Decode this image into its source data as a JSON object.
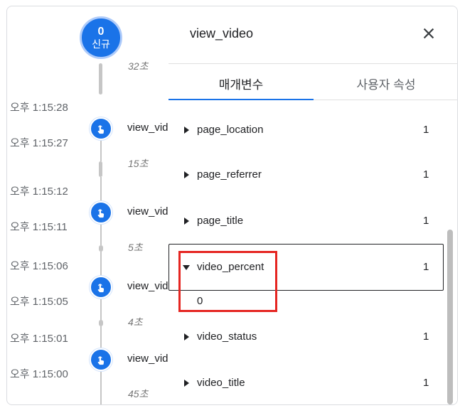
{
  "timeline": {
    "new_badge": {
      "count": "0",
      "label": "신규"
    },
    "gaps": [
      "32초",
      "15초",
      "5초",
      "4초",
      "45초"
    ],
    "events": [
      {
        "name": "view_video",
        "time_start": "오후 1:15:28",
        "time_end": "오후 1:15:27"
      },
      {
        "name": "view_video",
        "time_start": "오후 1:15:12",
        "time_end": "오후 1:15:11"
      },
      {
        "name": "view_video",
        "time_start": "오후 1:15:06",
        "time_end": "오후 1:15:05"
      },
      {
        "name": "view_video",
        "time_start": "오후 1:15:01",
        "time_end": "오후 1:15:00"
      }
    ],
    "icon": "touch-icon",
    "accent_color": "#1a73e8"
  },
  "panel": {
    "title": "view_video",
    "close_icon": "close-icon",
    "tabs": [
      {
        "label": "매개변수",
        "active": true
      },
      {
        "label": "사용자 속성",
        "active": false
      }
    ],
    "params": [
      {
        "name": "page_location",
        "count": "1",
        "expanded": false
      },
      {
        "name": "page_referrer",
        "count": "1",
        "expanded": false
      },
      {
        "name": "page_title",
        "count": "1",
        "expanded": false
      },
      {
        "name": "video_percent",
        "count": "1",
        "expanded": true,
        "value": "0"
      },
      {
        "name": "video_status",
        "count": "1",
        "expanded": false
      },
      {
        "name": "video_title",
        "count": "1",
        "expanded": false
      }
    ],
    "highlight_color": "#e52521"
  }
}
